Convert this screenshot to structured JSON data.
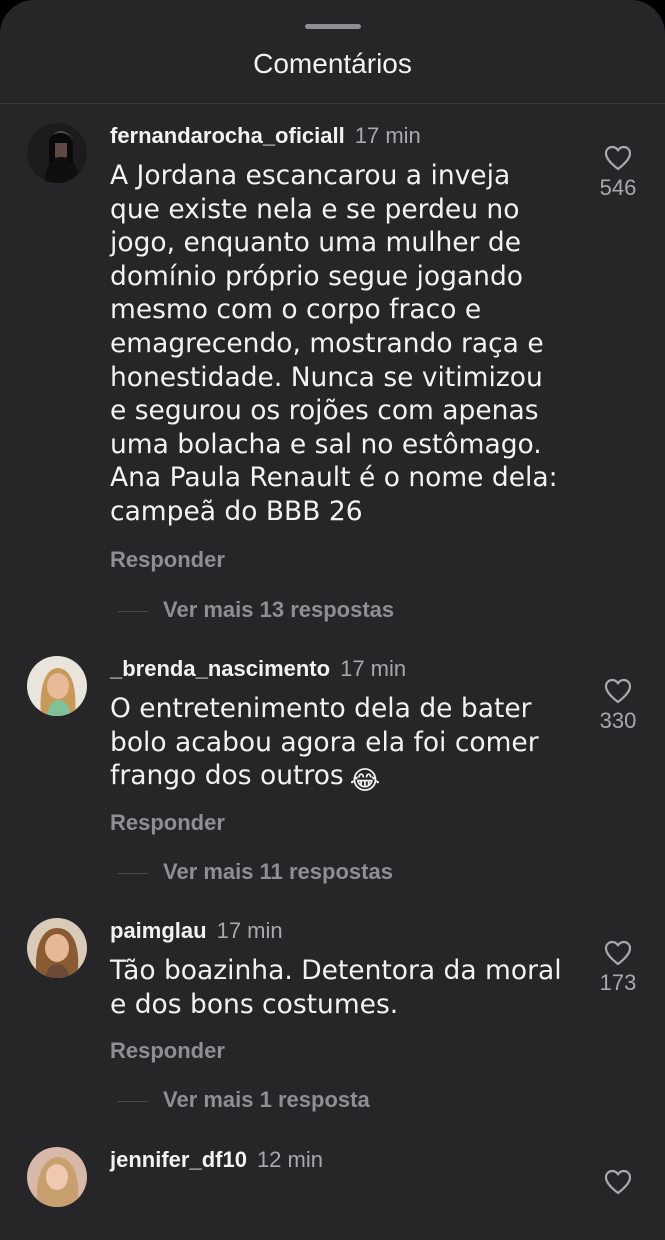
{
  "sheet": {
    "title": "Comentários"
  },
  "comments": [
    {
      "username": "fernandarocha_oficiall",
      "time": "17 min",
      "text": "A Jordana escancarou a inveja\nque existe nela e se perdeu no\njogo, enquanto uma mulher de\ndomínio próprio segue jogando\nmesmo com o corpo fraco e\nemagrecendo, mostrando raça e\nhonestidade. Nunca se vitimizou\ne segurou os rojões com apenas\numa bolacha e sal no estômago.\nAna Paula Renault é o nome dela:\ncampeã do BBB 26",
      "likes": "546",
      "reply_label": "Responder",
      "more_replies": "Ver mais 13 respostas"
    },
    {
      "username": "_brenda_nascimento",
      "time": "17 min",
      "text": "O entretenimento dela de bater\nbolo acabou agora ela foi comer\nfrango dos outros",
      "emoji": "😂",
      "likes": "330",
      "reply_label": "Responder",
      "more_replies": "Ver mais 11 respostas"
    },
    {
      "username": "paimglau",
      "time": "17 min",
      "text": "Tão boazinha. Detentora da moral\ne dos bons costumes.",
      "likes": "173",
      "reply_label": "Responder",
      "more_replies": "Ver mais 1 resposta"
    },
    {
      "username": "jennifer_df10",
      "time": "12 min",
      "text": ""
    }
  ]
}
